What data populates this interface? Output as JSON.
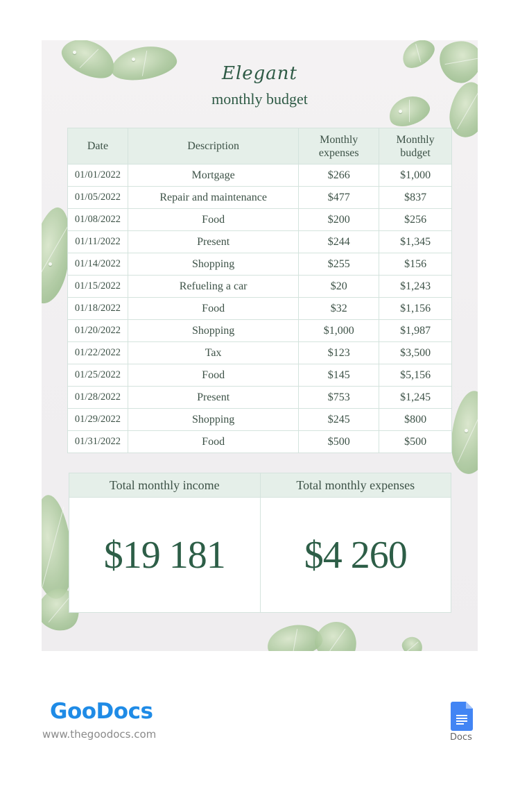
{
  "header": {
    "title_script": "Elegant",
    "title_sub": "monthly budget"
  },
  "table": {
    "columns": [
      "Date",
      "Description",
      "Monthly expenses",
      "Monthly budget"
    ],
    "column_lines": [
      [
        "Date"
      ],
      [
        "Description"
      ],
      [
        "Monthly",
        "expenses"
      ],
      [
        "Monthly",
        "budget"
      ]
    ],
    "rows": [
      {
        "date": "01/01/2022",
        "description": "Mortgage",
        "expense": "$266",
        "budget": "$1,000"
      },
      {
        "date": "01/05/2022",
        "description": "Repair and maintenance",
        "expense": "$477",
        "budget": "$837"
      },
      {
        "date": "01/08/2022",
        "description": "Food",
        "expense": "$200",
        "budget": "$256"
      },
      {
        "date": "01/11/2022",
        "description": "Present",
        "expense": "$244",
        "budget": "$1,345"
      },
      {
        "date": "01/14/2022",
        "description": "Shopping",
        "expense": "$255",
        "budget": "$156"
      },
      {
        "date": "01/15/2022",
        "description": "Refueling a car",
        "expense": "$20",
        "budget": "$1,243"
      },
      {
        "date": "01/18/2022",
        "description": "Food",
        "expense": "$32",
        "budget": "$1,156"
      },
      {
        "date": "01/20/2022",
        "description": "Shopping",
        "expense": "$1,000",
        "budget": "$1,987"
      },
      {
        "date": "01/22/2022",
        "description": "Tax",
        "expense": "$123",
        "budget": "$3,500"
      },
      {
        "date": "01/25/2022",
        "description": "Food",
        "expense": "$145",
        "budget": "$5,156"
      },
      {
        "date": "01/28/2022",
        "description": "Present",
        "expense": "$753",
        "budget": "$1,245"
      },
      {
        "date": "01/29/2022",
        "description": "Shopping",
        "expense": "$245",
        "budget": "$800"
      },
      {
        "date": "01/31/2022",
        "description": "Food",
        "expense": "$500",
        "budget": "$500"
      }
    ]
  },
  "totals": {
    "income_label": "Total monthly income",
    "income_value": "$19 181",
    "expenses_label": "Total monthly expenses",
    "expenses_value": "$4 260"
  },
  "footer": {
    "logo_text": "GooDocs",
    "site": "www.thegoodocs.com",
    "docs_label": "Docs",
    "docs_icon": "google-docs-icon"
  },
  "colors": {
    "accent_green": "#2e5a45",
    "header_fill": "#e5efe9",
    "border": "#d4e3dd",
    "logo_blue": "#1f8be6",
    "docs_blue": "#4285f4"
  }
}
